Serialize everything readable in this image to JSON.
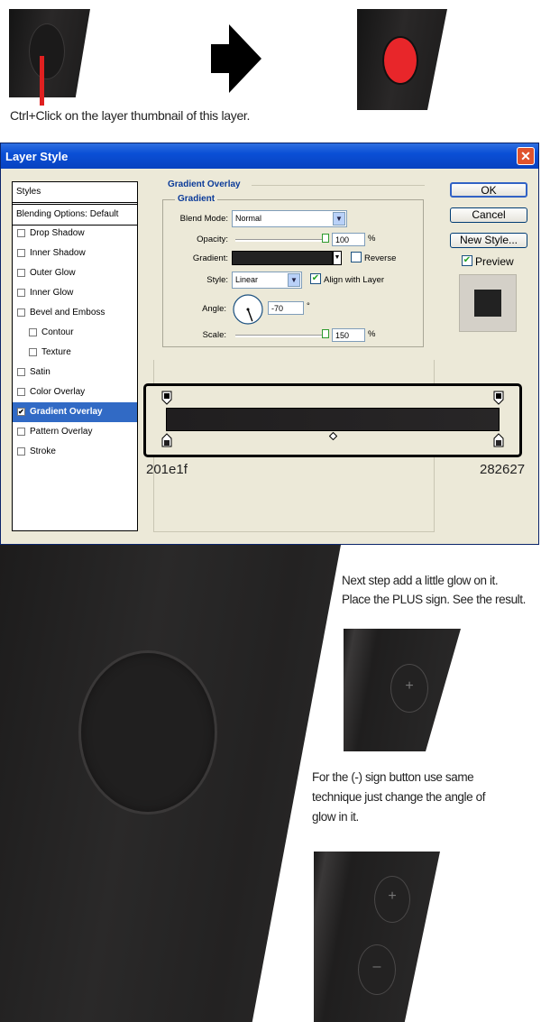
{
  "top": {
    "caption": "Ctrl+Click on the layer thumbnail of this layer."
  },
  "dialog": {
    "title": "Layer Style",
    "close": "✕",
    "styles_list": [
      {
        "label": "Styles",
        "checkbox": false,
        "checked": false
      },
      {
        "label": "Blending Options: Default",
        "checkbox": false,
        "checked": false
      },
      {
        "label": "Drop Shadow",
        "checkbox": true,
        "checked": false
      },
      {
        "label": "Inner Shadow",
        "checkbox": true,
        "checked": false
      },
      {
        "label": "Outer Glow",
        "checkbox": true,
        "checked": false
      },
      {
        "label": "Inner Glow",
        "checkbox": true,
        "checked": false
      },
      {
        "label": "Bevel and Emboss",
        "checkbox": true,
        "checked": false
      },
      {
        "label": "Contour",
        "checkbox": true,
        "checked": false
      },
      {
        "label": "Texture",
        "checkbox": true,
        "checked": false
      },
      {
        "label": "Satin",
        "checkbox": true,
        "checked": false
      },
      {
        "label": "Color Overlay",
        "checkbox": true,
        "checked": false
      },
      {
        "label": "Gradient Overlay",
        "checkbox": true,
        "checked": true
      },
      {
        "label": "Pattern Overlay",
        "checkbox": true,
        "checked": false
      },
      {
        "label": "Stroke",
        "checkbox": true,
        "checked": false
      }
    ],
    "section_title": "Gradient Overlay",
    "group_title": "Gradient",
    "blend_mode": {
      "label": "Blend Mode:",
      "value": "Normal"
    },
    "opacity": {
      "label": "Opacity:",
      "value": "100",
      "unit": "%",
      "level": 1.0
    },
    "gradient": {
      "label": "Gradient:",
      "reverse_label": "Reverse",
      "reverse_checked": false
    },
    "style": {
      "label": "Style:",
      "value": "Linear",
      "align_label": "Align with Layer",
      "align_checked": true
    },
    "angle": {
      "label": "Angle:",
      "value": "-70",
      "unit": "°",
      "degrees": -70
    },
    "scale": {
      "label": "Scale:",
      "value": "150",
      "unit": "%",
      "level": 1.0
    },
    "buttons": {
      "ok": "OK",
      "cancel": "Cancel",
      "new_style": "New Style...",
      "preview": "Preview",
      "preview_checked": true
    },
    "gradient_start": "201e1f",
    "gradient_end": "282627",
    "colors": {
      "start": "#201e1f",
      "end": "#282627",
      "selected": "#316ac5",
      "title": "#0a4fd6"
    }
  },
  "notes": {
    "glow_text_1": "Next step add a little glow on it.",
    "glow_text_2": "Place the PLUS sign. See the result.",
    "minus_text_1": "For the (-) sign button use same",
    "minus_text_2": "technique just change the angle of",
    "minus_text_3": "glow in it.",
    "plus_sign": "+",
    "minus_sign": "–"
  }
}
